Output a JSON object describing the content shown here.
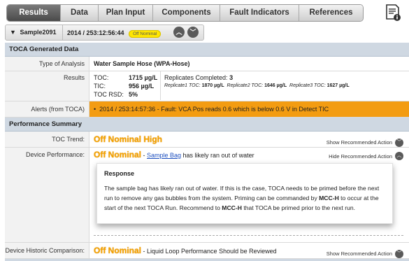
{
  "tabs": [
    {
      "label": "Results",
      "active": true
    },
    {
      "label": "Data",
      "active": false
    },
    {
      "label": "Plan Input",
      "active": false
    },
    {
      "label": "Components",
      "active": false
    },
    {
      "label": "Fault Indicators",
      "active": false
    },
    {
      "label": "References",
      "active": false
    }
  ],
  "sample": {
    "toggle": "▼",
    "name": "Sample2091",
    "timestamp": "2014 / 253:12:56:44",
    "status_badge": "Off Nominal"
  },
  "toca": {
    "header": "TOCA Generated Data",
    "analysis_label": "Type of Analysis",
    "analysis_value": "Water Sample Hose (WPA-Hose)",
    "results_label": "Results",
    "toc_label": "TOC:",
    "toc_value": "1715 µg/L",
    "tic_label": "TIC:",
    "tic_value": "956 µg/L",
    "tocrsd_label": "TOC RSD:",
    "tocrsd_value": "5%",
    "replicates_label": "Replicates Completed:",
    "replicates_value": "3",
    "rep1_label": "Replicate1 TOC:",
    "rep1_value": "1870 µg/L",
    "rep2_label": "Replicate2 TOC:",
    "rep2_value": "1646 µg/L",
    "rep3_label": "Replicate3 TOC:",
    "rep3_value": "1627 µg/L",
    "alerts_label": "Alerts (from TOCA)",
    "alert_text": "2014 / 253:14:57:36 - Fault: VCA Pos reads 0.6 which is below 0.6 V in Detect TIC"
  },
  "performance": {
    "header": "Performance Summary",
    "trend_label": "TOC Trend:",
    "trend_value": "Off Nominal High",
    "show_action": "Show Recommended Action",
    "device_label": "Device Performance:",
    "device_status": "Off Nominal",
    "device_dash": " - ",
    "device_link": "Sample Bag",
    "device_text": " has likely ran out of water",
    "hide_action": "Hide Recommended Action",
    "response_title": "Response",
    "response_parts": [
      "The sample bag has likely ran out of water. If this is the case, TOCA needs to be primed before the next run to remove any gas bubbles from the system. Priming can be commanded by ",
      "MCC-H",
      " to occur at the start of the next TOCA Run. Recommend to ",
      "MCC-H",
      " that TOCA be primed prior to the next run."
    ],
    "historic_label": "Device Historic Comparison:",
    "historic_status": "Off Nominal",
    "historic_text": " - Liquid Loop Performance Should be Reviewed",
    "show_action2": "Show Recommended Action"
  }
}
